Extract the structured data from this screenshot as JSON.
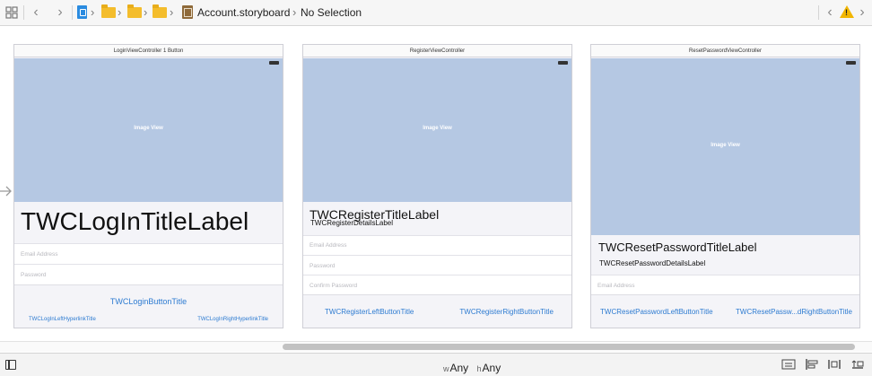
{
  "jumpbar": {
    "storyboard_name": "Account.storyboard",
    "selection": "No Selection"
  },
  "scenes": [
    {
      "title": "LoginViewController 1 Button",
      "image_view_label": "Image View",
      "title_label": "TWCLogInTitleLabel",
      "fields": [
        "Email Address",
        "Password"
      ],
      "primary_button": "TWCLoginButtonTitle",
      "left_link": "TWCLogInLeftHyperlinkTitle",
      "right_link": "TWCLogInRightHyperlinkTitle"
    },
    {
      "title": "RegisterViewController",
      "image_view_label": "Image View",
      "title_label": "TWCRegisterTitleLabel",
      "details_label": "TWCRegisterDetailsLabel",
      "fields": [
        "Email Address",
        "Password",
        "Confirm Password"
      ],
      "left_button": "TWCRegisterLeftButtonTitle",
      "right_button": "TWCRegisterRightButtonTitle"
    },
    {
      "title": "ResetPasswordViewController",
      "image_view_label": "Image View",
      "title_label": "TWCResetPasswordTitleLabel",
      "details_label": "TWCResetPasswordDetailsLabel",
      "fields": [
        "Email Address"
      ],
      "left_button": "TWCResetPasswordLeftButtonTitle",
      "right_button": "TWCResetPassw...dRightButtonTitle"
    }
  ],
  "bottombar": {
    "width_prefix": "w",
    "width_value": "Any",
    "height_prefix": "h",
    "height_value": "Any"
  },
  "icons": {
    "grid": "grid-icon",
    "back": "chevron-left-icon",
    "forward": "chevron-right-icon",
    "warning": "warning-icon"
  },
  "colors": {
    "image_view": "#b5c8e3",
    "link": "#2d7bd1",
    "folder": "#f4bd2c",
    "warning": "#f2b600"
  }
}
